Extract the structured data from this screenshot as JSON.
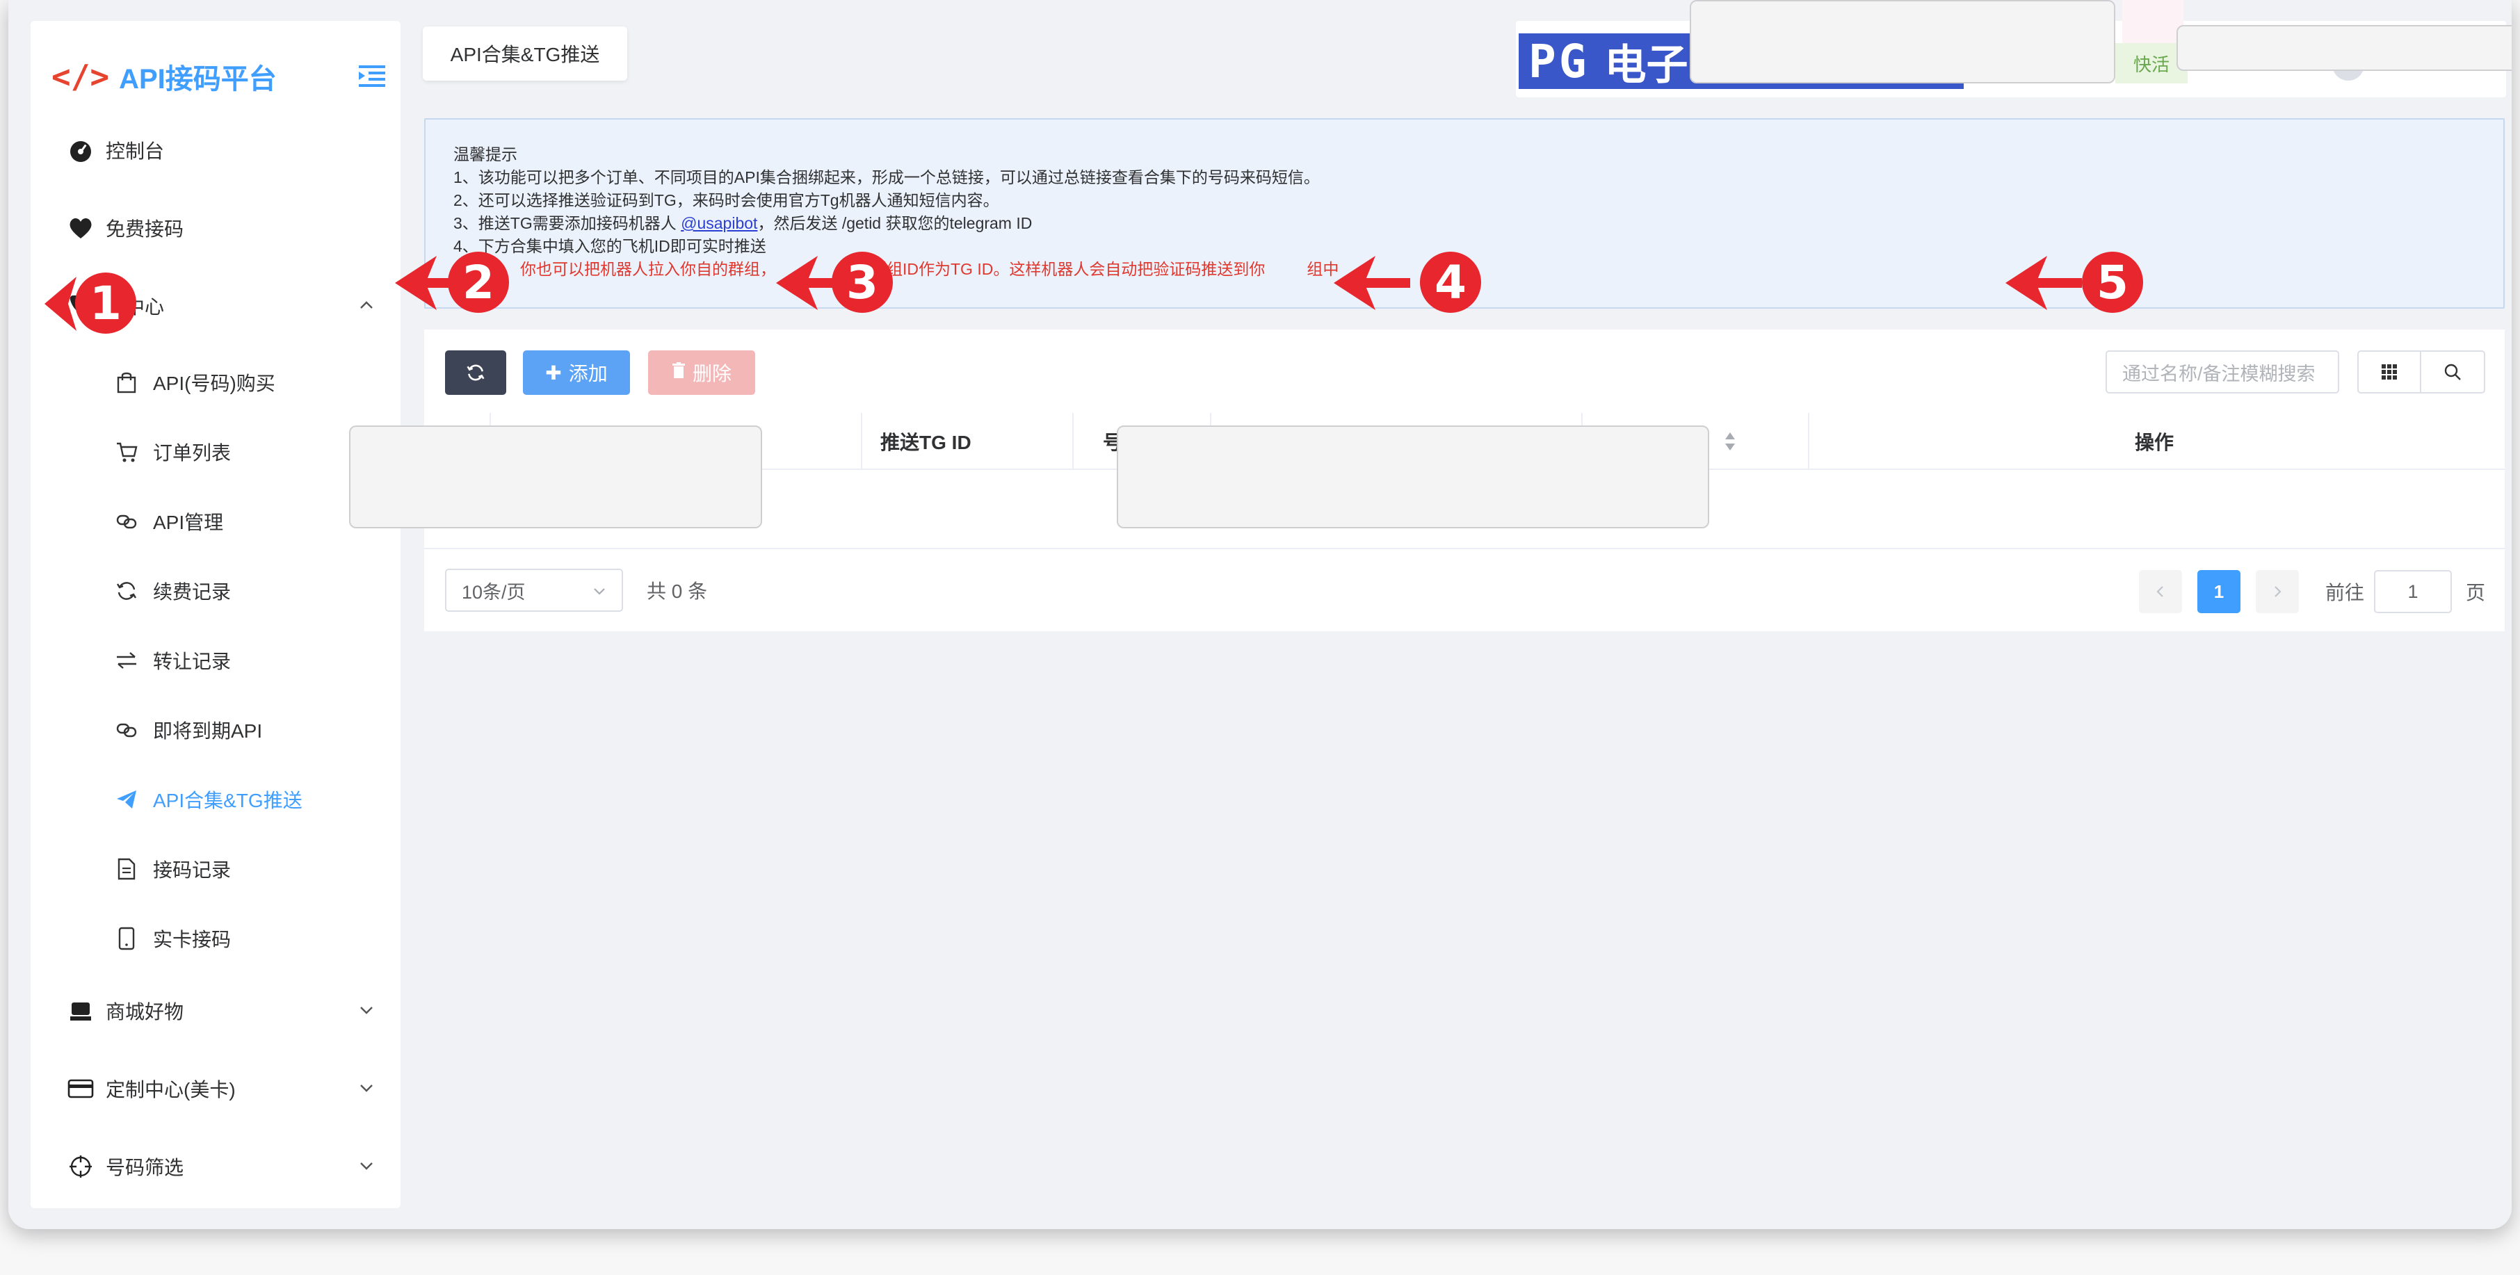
{
  "sidebar": {
    "logo_mark": "</>",
    "logo_text": "API接码平台",
    "items": [
      {
        "label": "控制台"
      },
      {
        "label": "免费接码"
      },
      {
        "label": "码中心"
      },
      {
        "label": "商城好物"
      },
      {
        "label": "定制中心(美卡)"
      },
      {
        "label": "号码筛选"
      }
    ],
    "sub_items": [
      {
        "label": "API(号码)购买"
      },
      {
        "label": "订单列表"
      },
      {
        "label": "API管理"
      },
      {
        "label": "续费记录"
      },
      {
        "label": "转让记录"
      },
      {
        "label": "即将到期API"
      },
      {
        "label": "API合集&TG推送"
      },
      {
        "label": "接码记录"
      },
      {
        "label": "实卡接码"
      }
    ]
  },
  "header": {
    "tab_label": "API合集&TG推送",
    "banner_text_1": "PG",
    "banner_text_2": "电子",
    "chip_text": "快活"
  },
  "tips": {
    "title": "温馨提示",
    "line1": "1、该功能可以把多个订单、不同项目的API集合捆绑起来，形成一个总链接，可以通过总链接查看合集下的号码来码短信。",
    "line2": "2、还可以选择推送验证码到TG，来码时会使用官方Tg机器人通知短信内容。",
    "line3_a": "3、推送TG需要添加接码机器人 ",
    "line3_link": "@usapibot",
    "line3_b": "，然后发送 /getid 获取您的telegram ID",
    "line4": "4、下方合集中填入您的飞机ID即可实时推送",
    "line5_red_a": "你也可以把机器人拉入你自的群组，",
    "line5_red_b": "获取群组ID作为TG ID。这样机器人会自动把验证码推送到你",
    "line5_red_c": "组中"
  },
  "toolbar": {
    "add_label": "添加",
    "delete_label": "删除",
    "search_placeholder": "通过名称/备注模糊搜索"
  },
  "table": {
    "columns": [
      "推送TG ID",
      "号",
      "操作"
    ]
  },
  "pager": {
    "page_size": "10条/页",
    "total": "共 0 条",
    "current_page": "1",
    "goto_label": "前往",
    "goto_value": "1",
    "page_suffix": "页"
  },
  "annotations": [
    "1",
    "2",
    "3",
    "4",
    "5"
  ],
  "colors": {
    "primary": "#409eff",
    "annotation_red": "#e8262d",
    "danger_light": "#f4b7b7",
    "dark_button": "#3c4455"
  }
}
